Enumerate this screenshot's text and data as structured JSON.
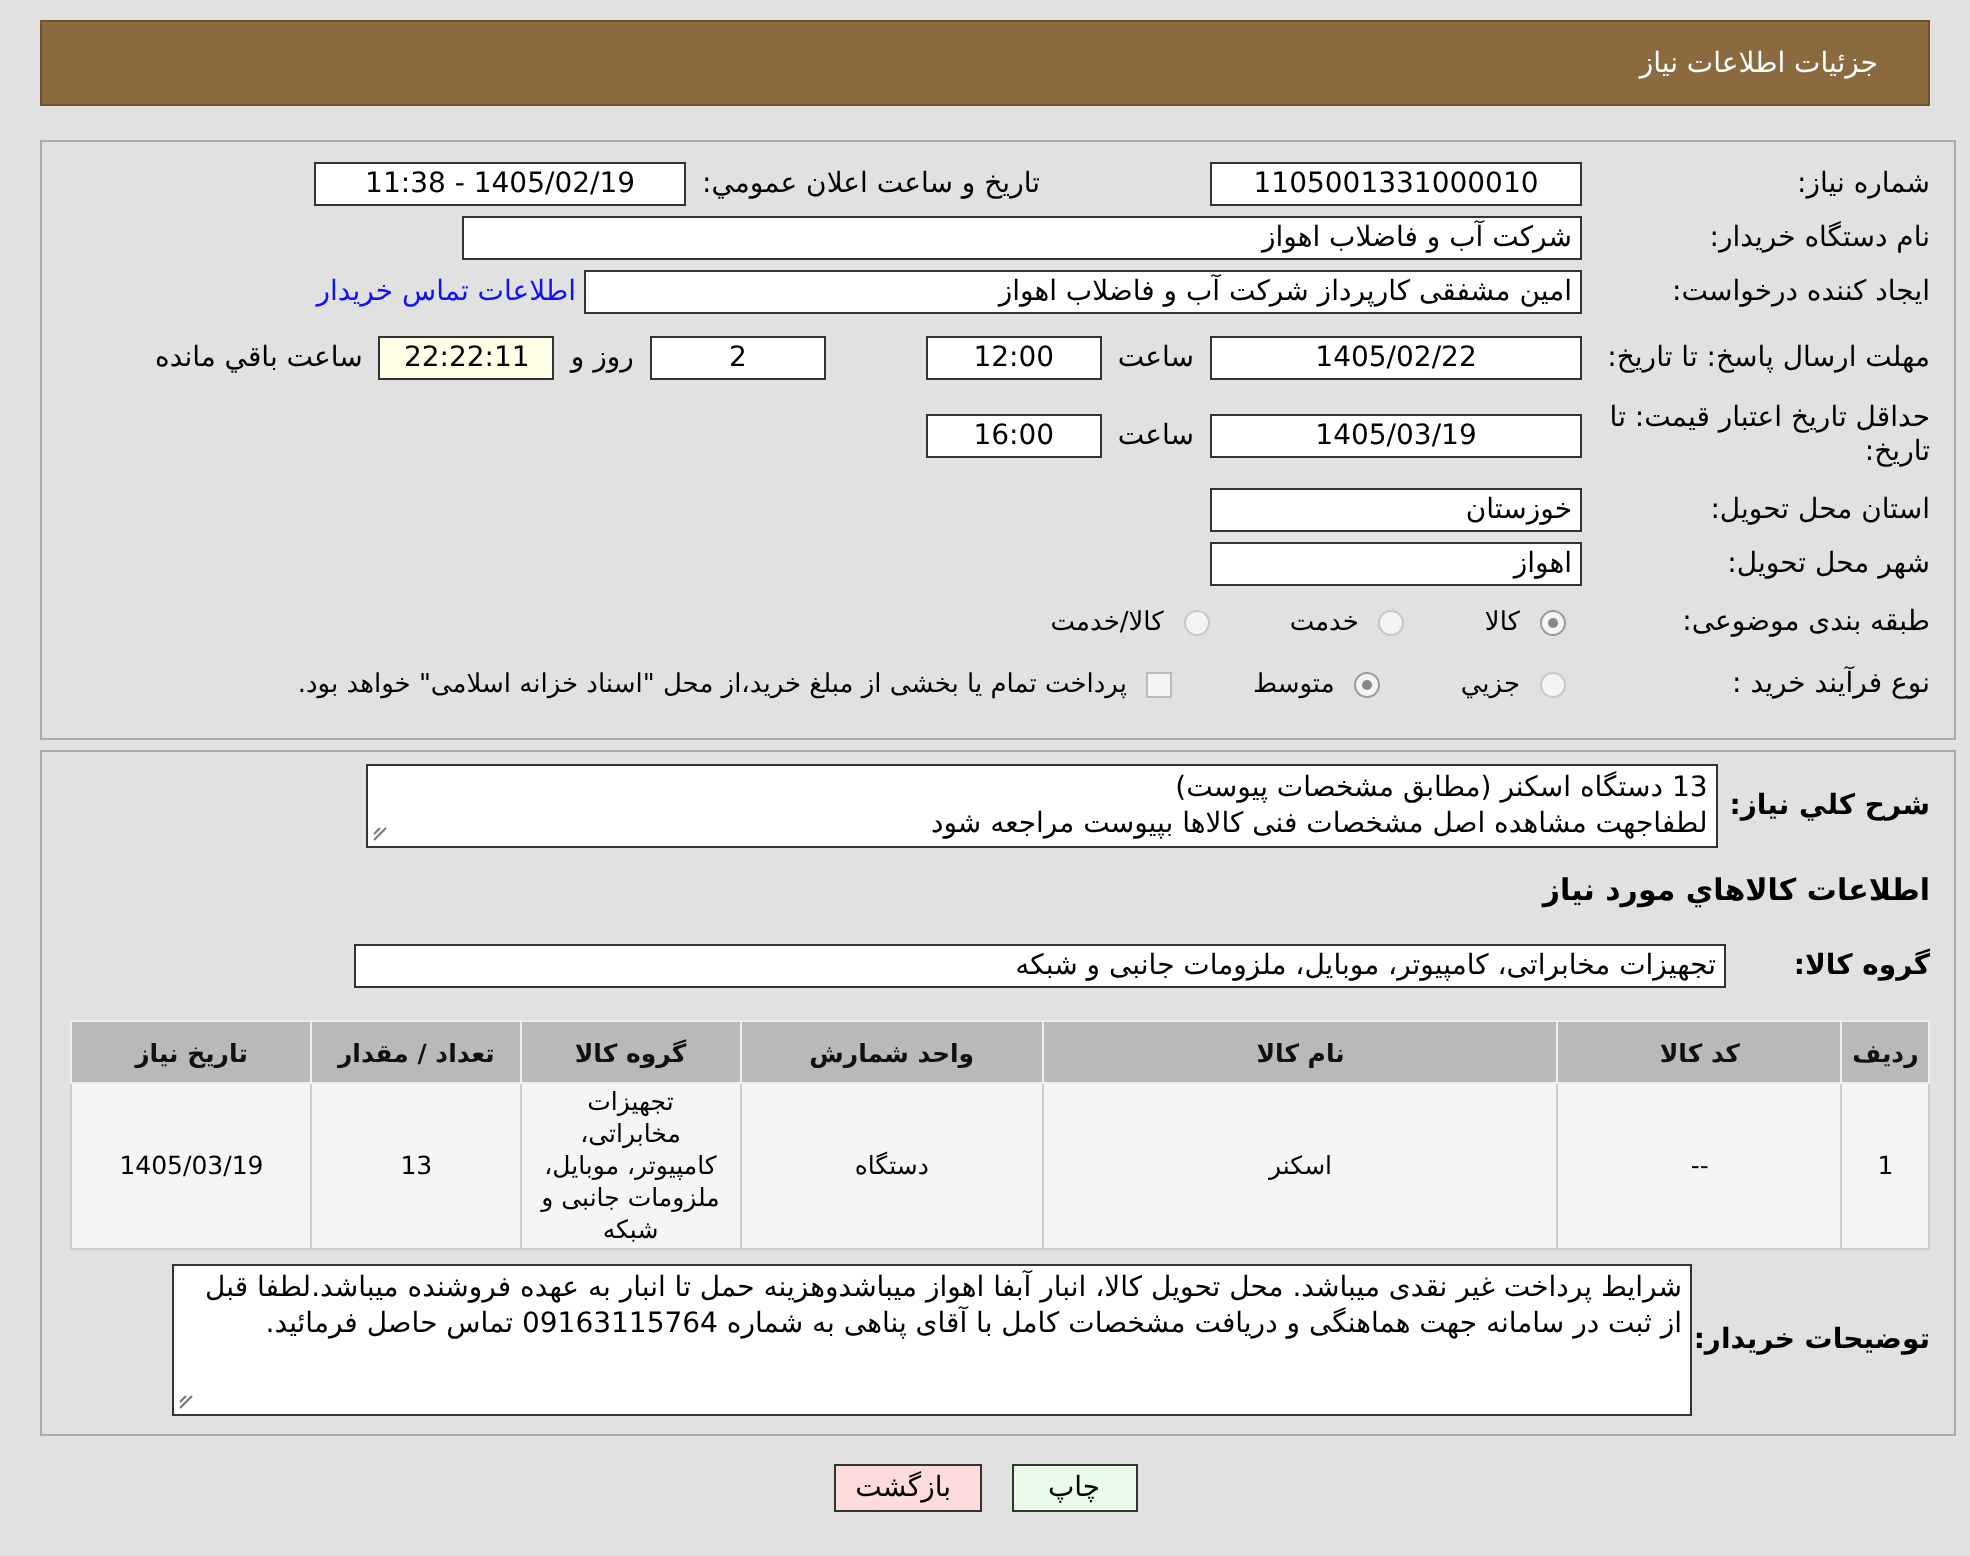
{
  "header": {
    "title": "جزئیات اطلاعات نیاز"
  },
  "details": {
    "need_number": {
      "label": "شماره نیاز:",
      "value": "1105001331000010"
    },
    "announce": {
      "label": "تاریخ و ساعت اعلان عمومي:",
      "value": "1405/02/19 - 11:38"
    },
    "buyer_org": {
      "label": "نام دستگاه خریدار:",
      "value": "شرکت آب و فاضلاب اهواز"
    },
    "requester": {
      "label": "ایجاد کننده درخواست:",
      "value": "امین مشفقی کارپرداز شرکت آب و فاضلاب اهواز",
      "link": "اطلاعات تماس خریدار"
    },
    "reply_deadline": {
      "label": "مهلت ارسال پاسخ: تا تاریخ:",
      "date": "1405/02/22",
      "time_label": "ساعت",
      "time": "12:00",
      "days": "2",
      "days_label": "روز و",
      "remaining": "22:22:11",
      "remaining_label": "ساعت باقي مانده"
    },
    "price_validity": {
      "label": "حداقل تاریخ اعتبار قیمت: تا تاریخ:",
      "date": "1405/03/19",
      "time_label": "ساعت",
      "time": "16:00"
    },
    "province": {
      "label": "استان محل تحویل:",
      "value": "خوزستان"
    },
    "city": {
      "label": "شهر محل تحویل:",
      "value": "اهواز"
    },
    "category": {
      "label": "طبقه بندی موضوعی:",
      "options": [
        {
          "label": "کالا",
          "selected": true
        },
        {
          "label": "خدمت",
          "selected": false
        },
        {
          "label": "کالا/خدمت",
          "selected": false
        }
      ]
    },
    "purchase_type": {
      "label": "نوع فرآیند خرید :",
      "options": [
        {
          "label": "جزيي",
          "selected": false
        },
        {
          "label": "متوسط",
          "selected": true
        }
      ],
      "payment_note": {
        "text": "پرداخت تمام یا بخشی از مبلغ خرید،از محل \"اسناد خزانه اسلامی\" خواهد بود.",
        "checked": false
      }
    }
  },
  "summary": {
    "label": "شرح کلي نیاز:",
    "lines": [
      "13 دستگاه اسکنر (مطابق مشخصات پیوست)",
      "لطفاجهت مشاهده اصل مشخصات فنی کالاها بپیوست مراجعه شود"
    ]
  },
  "goods_heading": "اطلاعات کالاهاي مورد نیاز",
  "goods_group": {
    "label": "گروه کالا:",
    "value": "تجهیزات مخابراتی، کامپیوتر، موبایل، ملزومات جانبی و شبکه"
  },
  "table": {
    "columns": [
      "ردیف",
      "کد کالا",
      "نام کالا",
      "واحد شمارش",
      "گروه کالا",
      "تعداد / مقدار",
      "تاریخ نیاز"
    ],
    "rows": [
      [
        "1",
        "--",
        "اسکنر",
        "دستگاه",
        "تجهیزات مخابراتی، کامپیوتر، موبایل، ملزومات جانبی و شبکه",
        "13",
        "1405/03/19"
      ]
    ]
  },
  "buyer_notes": {
    "label": "توضیحات خریدار:",
    "value": "شرایط پرداخت غیر نقدی میباشد. محل تحویل کالا، انبار آبفا اهواز میباشدوهزینه حمل تا انبار به عهده فروشنده میباشد.لطفا قبل از ثبت در سامانه جهت هماهنگی و دریافت مشخصات کامل با آقای  پناهی به شماره 09163115764 تماس حاصل فرمائید."
  },
  "buttons": [
    {
      "label": "چاپ",
      "kind": "print"
    },
    {
      "label": "بازگشت",
      "kind": "back"
    }
  ]
}
